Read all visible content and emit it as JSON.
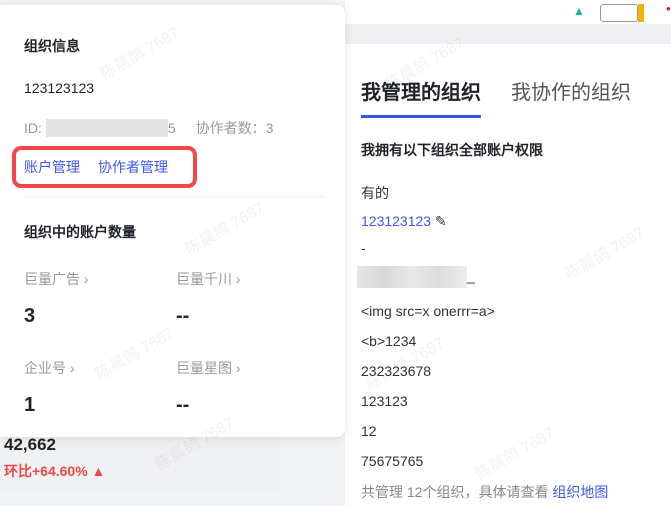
{
  "popover": {
    "title": "组织信息",
    "org_name": "123123123",
    "id_label": "ID:",
    "id_suffix": "5",
    "collaborators": "协作者数：3",
    "account_manage": "账户管理",
    "collaborator_manage": "协作者管理",
    "accounts_title": "组织中的账户数量",
    "stats": [
      {
        "label": "巨量广告 ›",
        "value": "3"
      },
      {
        "label": "巨量千川 ›",
        "value": "--"
      },
      {
        "label": "企业号 ›",
        "value": "1"
      },
      {
        "label": "巨量星图 ›",
        "value": "--"
      }
    ]
  },
  "background_card": {
    "value": "42,662",
    "change": "环比+64.60% ▲"
  },
  "right": {
    "tabs": [
      "我管理的组织",
      "我协作的组织"
    ],
    "section_title": "我拥有以下组织全部账户权限",
    "items": [
      "有的",
      "123123123",
      "-",
      "<img src=x onerrr=a>",
      "<b>1234",
      "232323678",
      "123123",
      "12",
      "75675765"
    ],
    "footer_text": "共管理 12个组织，具体请查看 ",
    "footer_link": "组织地图"
  },
  "watermark": "陈晨鸽 7687",
  "colors": {
    "link": "#3f57f0",
    "accent": "#3355ee",
    "highlight": "#f04848",
    "positive": "#f04848"
  }
}
